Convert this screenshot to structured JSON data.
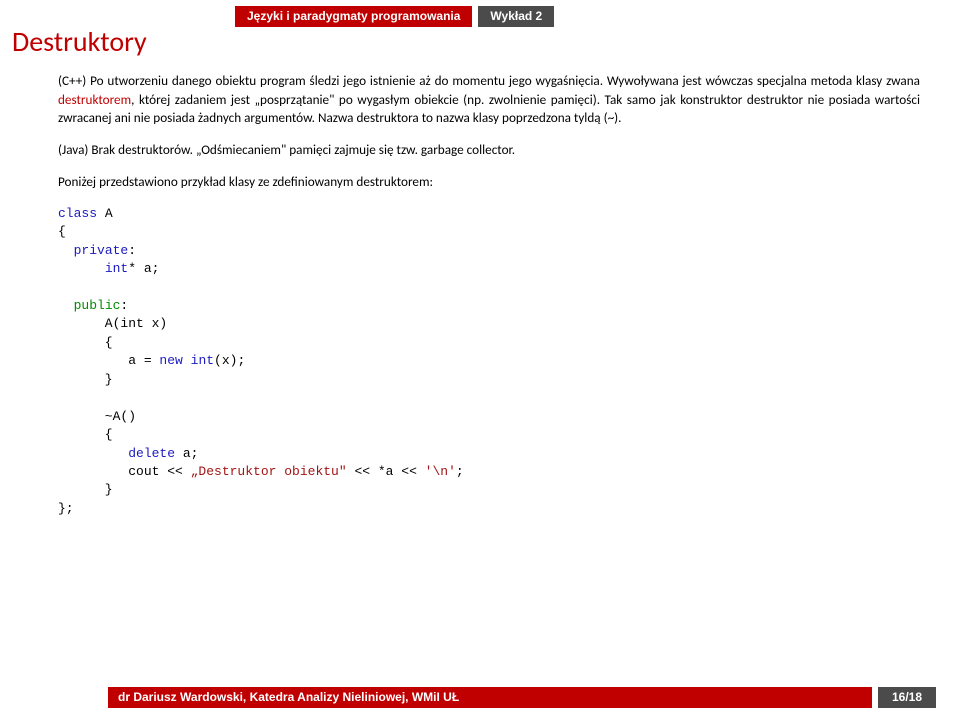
{
  "header": {
    "course": "Języki i paradygmaty programowania",
    "lecture": "Wykład 2"
  },
  "title": "Destruktory",
  "body": {
    "p1_a": "(C++) Po utworzeniu danego obiektu program śledzi jego istnienie aż do momentu jego wygaśnięcia. Wywoływana jest wówczas specjalna metoda klasy zwana ",
    "p1_destr": "destruktorem",
    "p1_b": ", której zadaniem jest „posprzątanie\" po wygasłym obiekcie (np. zwolnienie pamięci). Tak samo jak konstruktor destruktor nie posiada wartości zwracanej ani nie posiada żadnych argumentów. Nazwa destruktora to nazwa klasy poprzedzona tyldą (~).",
    "p2": "(Java) Brak destruktorów. „Odśmiecaniem\" pamięci zajmuje się tzw. garbage collector.",
    "p3": "Poniżej przedstawiono przykład klasy ze zdefiniowanym destruktorem:"
  },
  "code": {
    "l1a": "class",
    "l1b": " A",
    "l2": "{",
    "l3a": "  ",
    "l3b": "private",
    "l3c": ":",
    "l4a": "      ",
    "l4b": "int",
    "l4c": "* a;",
    "l5": "",
    "l6a": "  ",
    "l6b": "public",
    "l6c": ":",
    "l7": "      A(int x)",
    "l8": "      {",
    "l9a": "         a = ",
    "l9b": "new",
    "l9c": " ",
    "l9d": "int",
    "l9e": "(x);",
    "l10": "      }",
    "l11": "",
    "l12": "      ~A()",
    "l13": "      {",
    "l14a": "         ",
    "l14b": "delete",
    "l14c": " a;",
    "l15a": "         cout << ",
    "l15b": "„Destruktor obiektu\"",
    "l15c": " << *a << ",
    "l15d": "'\\n'",
    "l15e": ";",
    "l16": "      }",
    "l17": "};"
  },
  "footer": {
    "author": "dr Dariusz Wardowski, Katedra Analizy Nieliniowej, WMiI UŁ",
    "page": "16/18"
  }
}
